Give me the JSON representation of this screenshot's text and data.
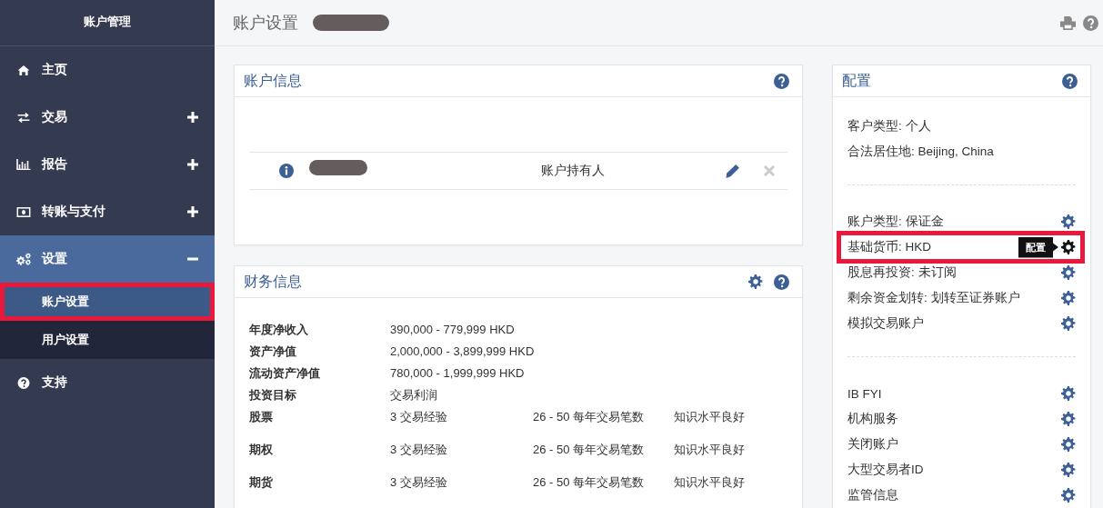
{
  "sidebar": {
    "title": "账户管理",
    "items": [
      {
        "label": "主页",
        "kind": "link",
        "selected": false
      },
      {
        "label": "交易",
        "kind": "group",
        "expanded": false,
        "selected": false
      },
      {
        "label": "报告",
        "kind": "group",
        "expanded": false,
        "selected": false
      },
      {
        "label": "转账与支付",
        "kind": "group",
        "expanded": false,
        "selected": false
      },
      {
        "label": "设置",
        "kind": "group",
        "expanded": true,
        "selected": true,
        "children": [
          {
            "label": "账户设置",
            "selected": true,
            "highlighted": true
          },
          {
            "label": "用户设置",
            "selected": false,
            "highlighted": false
          }
        ]
      },
      {
        "label": "支持",
        "kind": "link",
        "selected": false
      }
    ]
  },
  "header": {
    "title": "账户设置"
  },
  "account_info": {
    "title": "账户信息",
    "rows": [
      {
        "role": "账户持有人",
        "editable": true,
        "removable": false
      }
    ]
  },
  "financial_info": {
    "title": "财务信息",
    "rows": [
      {
        "label": "年度净收入",
        "cells": [
          "390,000 - 779,999 HKD"
        ]
      },
      {
        "label": "资产净值",
        "cells": [
          "2,000,000 - 3,899,999 HKD"
        ]
      },
      {
        "label": "流动资产净值",
        "cells": [
          "780,000 - 1,999,999 HKD"
        ]
      },
      {
        "label": "投资目标",
        "cells": [
          "交易利润"
        ]
      },
      {
        "label": "股票",
        "cells": [
          "3 交易经验",
          "26 - 50 每年交易笔数",
          "知识水平良好"
        ]
      },
      {
        "label": "期权",
        "cells": [
          "3 交易经验",
          "26 - 50 每年交易笔数",
          "知识水平良好"
        ]
      },
      {
        "label": "期货",
        "cells": [
          "3 交易经验",
          "26 - 50 每年交易笔数",
          "知识水平良好"
        ]
      }
    ]
  },
  "configuration": {
    "title": "配置",
    "sections": [
      {
        "kind": "info",
        "rows": [
          {
            "label": "客户类型:",
            "value": "个人"
          },
          {
            "label": "合法居住地:",
            "value": "Beijing, China"
          }
        ]
      },
      {
        "kind": "settings",
        "rows": [
          {
            "label": "账户类型:",
            "value": "保证金"
          },
          {
            "label": "基础货币:",
            "value": "HKD",
            "highlighted": true,
            "tooltip": "配置"
          },
          {
            "label": "股息再投资:",
            "value": "未订阅"
          },
          {
            "label": "剩余资金划转:",
            "value": "划转至证券账户"
          },
          {
            "label": "模拟交易账户"
          }
        ]
      },
      {
        "kind": "settings",
        "rows": [
          {
            "label": "IB FYI"
          },
          {
            "label": "机构服务"
          },
          {
            "label": "关闭账户"
          },
          {
            "label": "大型交易者ID"
          },
          {
            "label": "监管信息"
          }
        ]
      }
    ]
  }
}
